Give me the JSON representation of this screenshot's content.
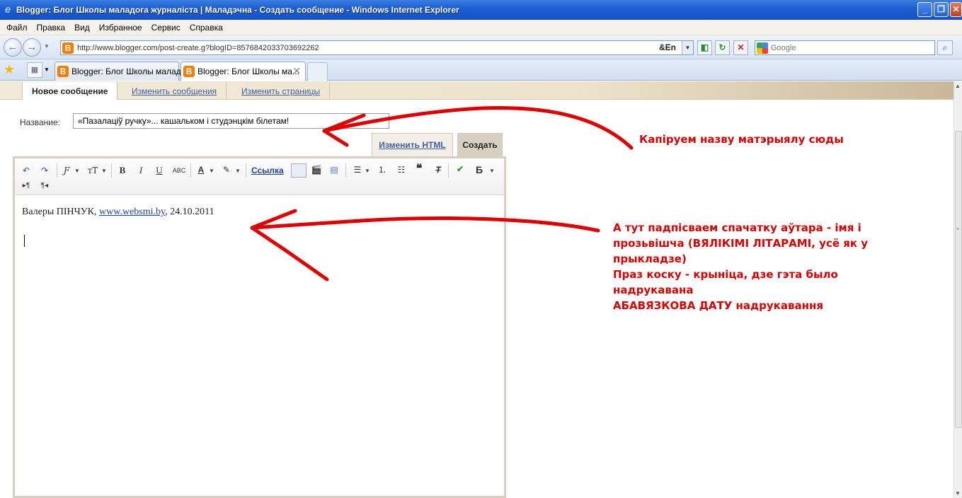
{
  "window": {
    "title": "Blogger: Блог Школы маладога журналіста | Маладэчна - Создать сообщение - Windows Internet Explorer",
    "minimize": "_",
    "maximize": "❐",
    "close": "✕"
  },
  "menu": [
    "Файл",
    "Правка",
    "Вид",
    "Избранное",
    "Сервис",
    "Справка"
  ],
  "address": {
    "url": "http://www.blogger.com/post-create.g?blogID=8576842033703692262",
    "lang_indicator": "&En"
  },
  "search": {
    "placeholder": "Google"
  },
  "tabs": [
    {
      "label": "Blogger: Блог Школы малад..."
    },
    {
      "label": "Blogger: Блог Школы ма..."
    }
  ],
  "blogger_tabs": {
    "new_post": "Новое сообщение",
    "edit_posts": "Изменить сообщения",
    "edit_pages": "Изменить страницы"
  },
  "post": {
    "title_label": "Название:",
    "title_value": "«Пазалацiў ручку»... кашальком і студэнцкім білетам!",
    "edit_html": "Изменить HTML",
    "compose": "Создать",
    "body_prefix": "Валеры ПІНЧУК, ",
    "body_link": "www.websmi.by",
    "body_suffix": ", 24.10.2011"
  },
  "toolbar": {
    "link_label": "Ссылка",
    "font_label": "Ƒ",
    "size_label": "тT",
    "bold": "B",
    "italic": "I",
    "underline": "U",
    "strike": "ABC",
    "text_color": "A",
    "lang": "Б",
    "ltr": "▸¶",
    "rtl": "¶◂"
  },
  "annotations": {
    "title_note": "Капіруем назву матэрыялу сюды",
    "body_note_lines": [
      "А тут падпісваем спачатку аўтара - імя і",
      "прозьвішча (ВЯЛІКІМІ ЛІТАРАМІ, усё як у",
      "прыкладзе)",
      "Праз коску - крыніца, дзе гэта было",
      "надрукавана",
      "АБАВЯЗКОВА ДАТУ надрукавання"
    ]
  },
  "colors": {
    "annotation": "#e00000",
    "titlebar": "#1d5fd2",
    "blogger_accent": "#d7cfbf"
  }
}
